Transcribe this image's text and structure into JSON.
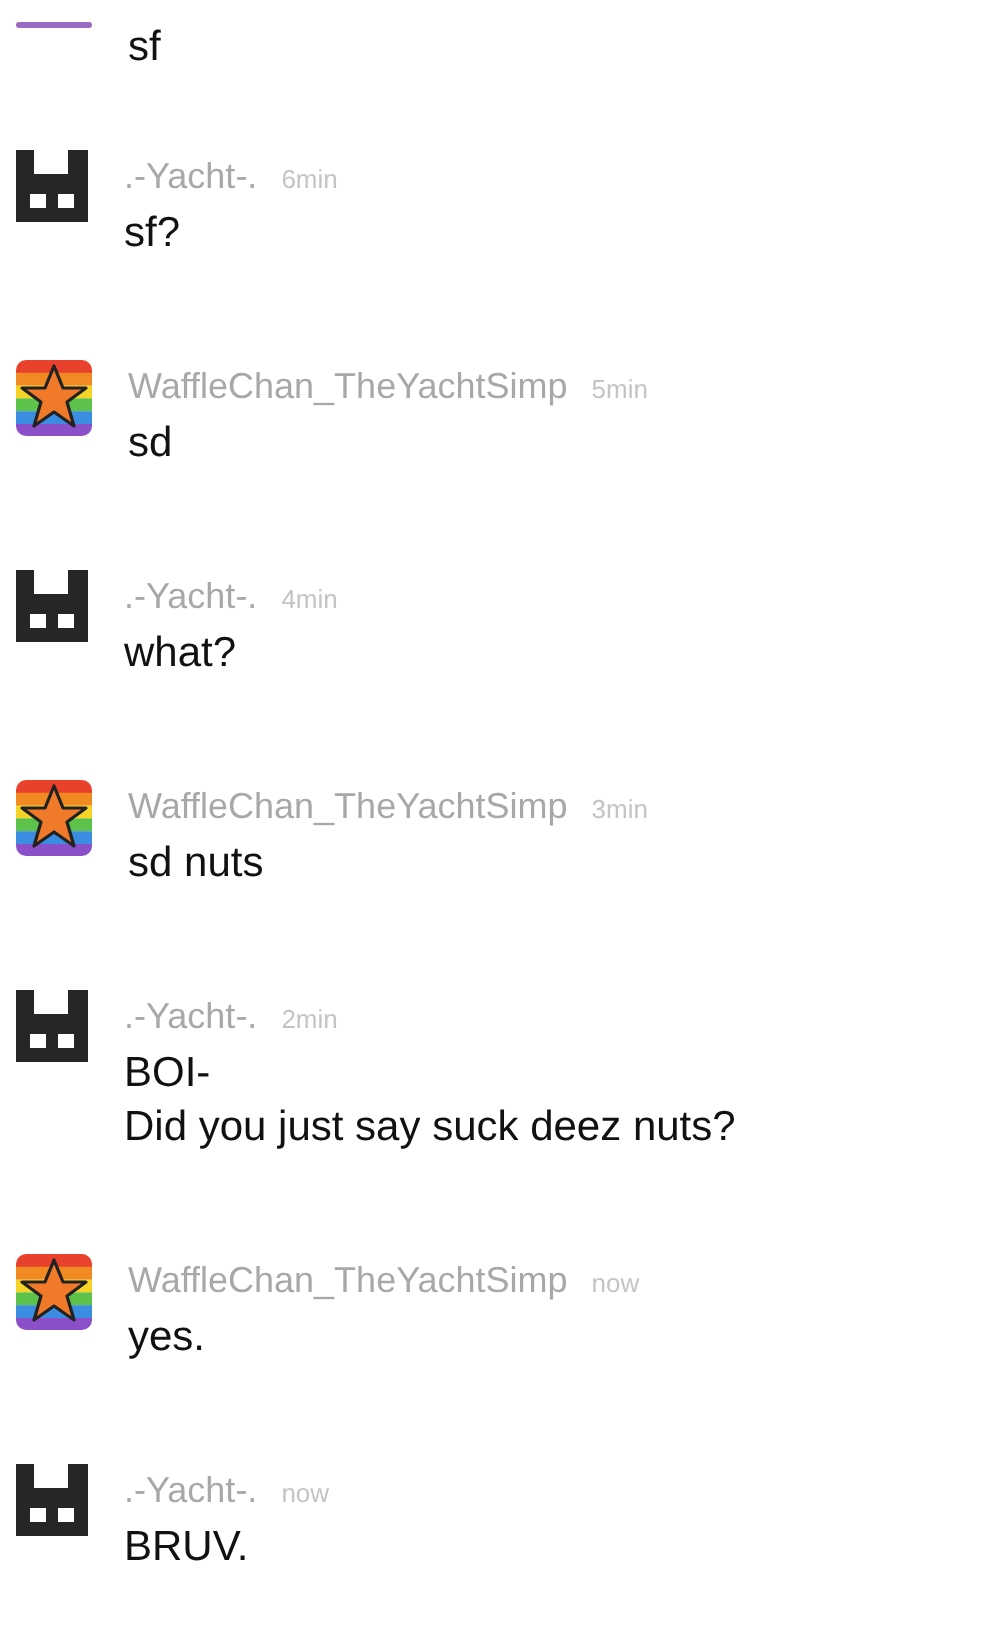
{
  "messages": [
    {
      "kind": "cut",
      "lines": [
        "sf"
      ]
    },
    {
      "kind": "blocky",
      "author": ".-Yacht-.",
      "time": "6min",
      "lines": [
        "sf?"
      ]
    },
    {
      "kind": "star",
      "author": "WaffleChan_TheYachtSimp",
      "time": "5min",
      "lines": [
        "sd"
      ]
    },
    {
      "kind": "blocky",
      "author": ".-Yacht-.",
      "time": "4min",
      "lines": [
        "what?"
      ]
    },
    {
      "kind": "star",
      "author": "WaffleChan_TheYachtSimp",
      "time": "3min",
      "lines": [
        "sd nuts"
      ]
    },
    {
      "kind": "blocky",
      "author": ".-Yacht-.",
      "time": "2min",
      "lines": [
        "BOI-",
        "Did you just say suck deez nuts?"
      ]
    },
    {
      "kind": "star",
      "author": "WaffleChan_TheYachtSimp",
      "time": "now",
      "lines": [
        "yes."
      ]
    },
    {
      "kind": "blocky",
      "author": ".-Yacht-.",
      "time": "now",
      "lines": [
        "BRUV."
      ]
    }
  ]
}
